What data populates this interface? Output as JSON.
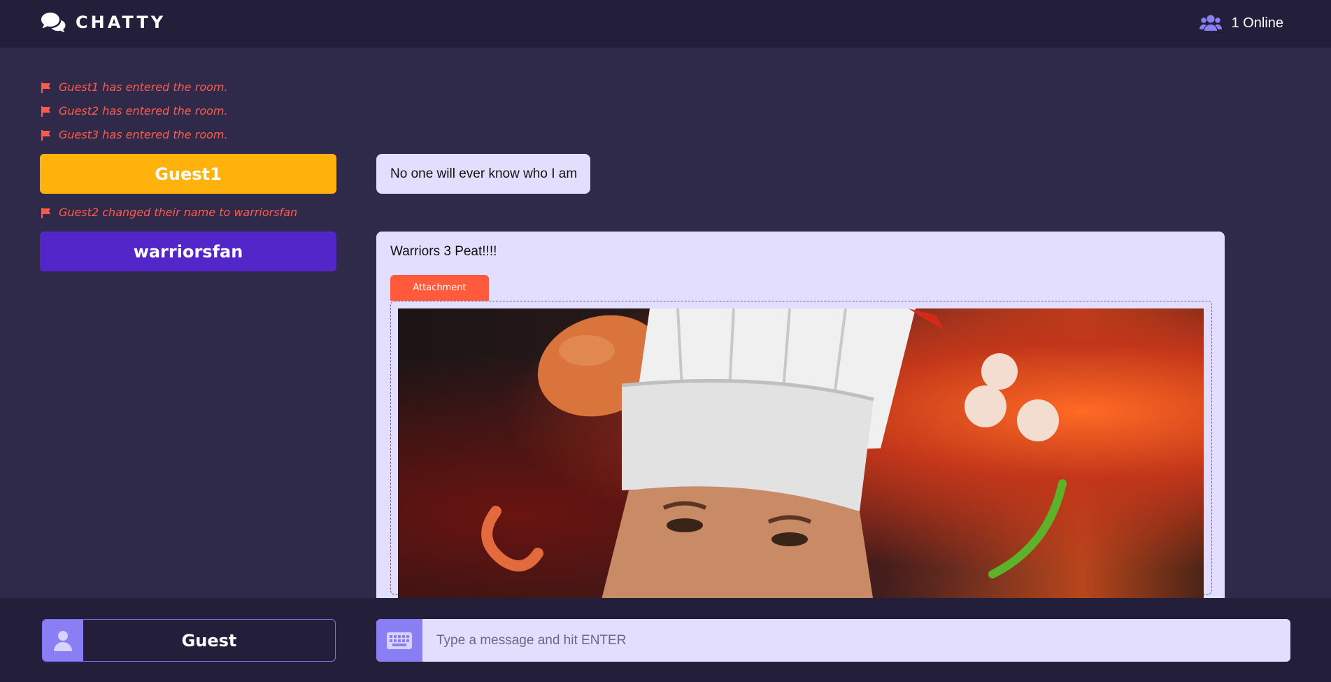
{
  "header": {
    "brand": "CHATTY",
    "brand_icon": "comments-icon",
    "online_icon": "users-icon",
    "online_text": "1 Online"
  },
  "notices": [
    "Guest1 has entered the room.",
    "Guest2 has entered the room.",
    "Guest3 has entered the room.",
    "Guest2 changed their name to warriorsfan"
  ],
  "users": [
    {
      "name": "Guest1",
      "color": "#ffb20b"
    },
    {
      "name": "warriorsfan",
      "color": "#5326c9"
    }
  ],
  "messages": [
    {
      "text": "No one will ever know who I am"
    },
    {
      "text": "Warriors 3 Peat!!!!",
      "attachment_label": "Attachment"
    }
  ],
  "footer": {
    "username": "Guest",
    "user_icon": "user-icon",
    "keyboard_icon": "keyboard-icon",
    "message_placeholder": "Type a message and hit ENTER"
  },
  "colors": {
    "background": "#2f2a4a",
    "header": "#231f3b",
    "accent": "#8a7ef5",
    "notice": "#ff5a4a",
    "bubble": "#e3defe",
    "attachment_tab": "#ff5a3c"
  }
}
